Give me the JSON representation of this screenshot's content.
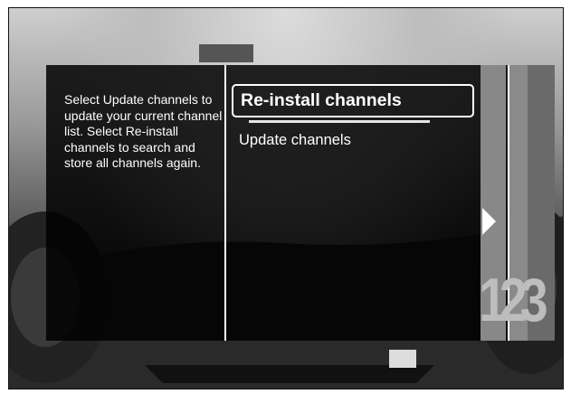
{
  "help": {
    "text": "Select Update channels to update your current channel list. Select Re-install channels to search and store all channels again."
  },
  "menu": {
    "items": [
      {
        "label": "Re-install channels",
        "selected": true
      },
      {
        "label": "Update channels",
        "selected": false
      }
    ]
  },
  "side": {
    "number_buttons": "123",
    "arrow_icon": "arrow-right-icon"
  },
  "colors": {
    "panel": "#000000",
    "text": "#ffffff",
    "side_strip": "#888888"
  }
}
